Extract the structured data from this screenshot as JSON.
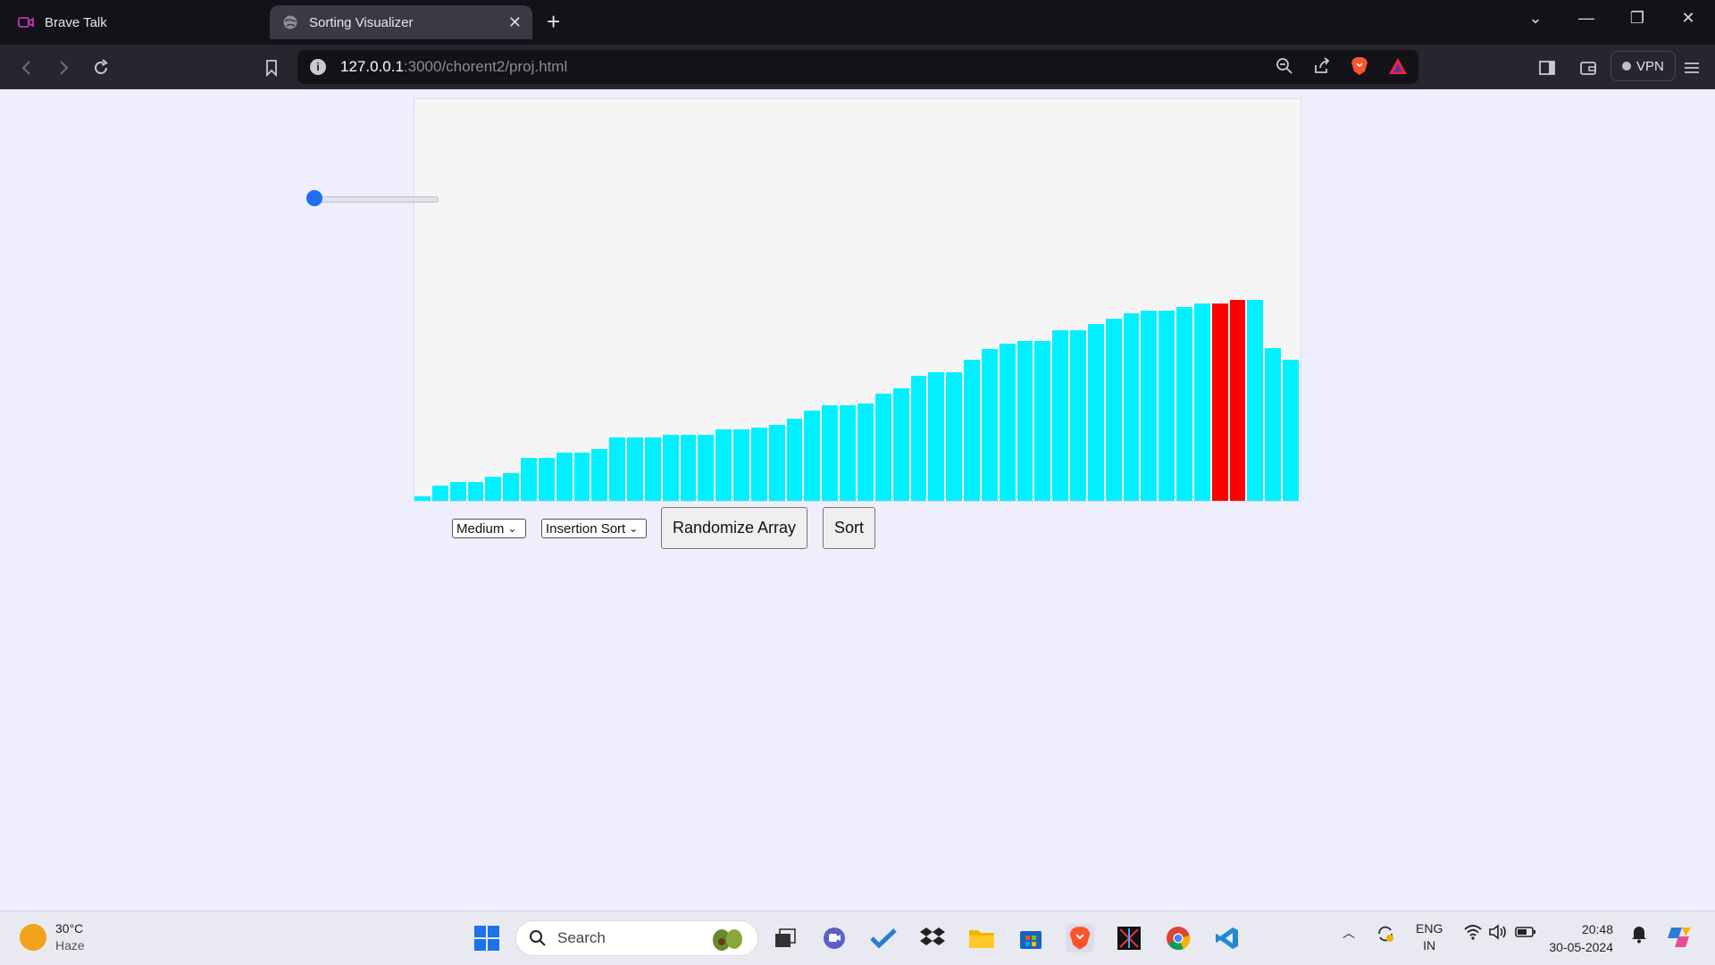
{
  "browser": {
    "tabs": [
      {
        "title": "Brave Talk",
        "active": false
      },
      {
        "title": "Sorting Visualizer",
        "active": true
      }
    ],
    "url_host": "127.0.0.1",
    "url_path": ":3000/chorent2/proj.html",
    "vpn_label": "VPN"
  },
  "controls": {
    "speed_select": "Medium",
    "algorithm_select": "Insertion Sort",
    "randomize_label": "Randomize Array",
    "sort_label": "Sort",
    "slider_value": 0
  },
  "colors": {
    "bar_default": "#00f0ff",
    "bar_active": "#ff0000",
    "canvas_bg": "#f5f5f5"
  },
  "chart_data": {
    "type": "bar",
    "max_value": 452,
    "values": [
      5,
      17,
      21,
      21,
      27,
      31,
      48,
      48,
      54,
      54,
      58,
      71,
      71,
      71,
      74,
      74,
      74,
      80,
      80,
      82,
      85,
      92,
      101,
      107,
      107,
      110,
      121,
      127,
      141,
      145,
      145,
      159,
      171,
      177,
      180,
      180,
      192,
      192,
      199,
      205,
      211,
      214,
      214,
      218,
      222,
      222,
      226,
      226,
      172,
      159
    ],
    "highlighted_indices": [
      45,
      46
    ]
  },
  "taskbar": {
    "temperature": "30°C",
    "weather": "Haze",
    "search_label": "Search",
    "lang_top": "ENG",
    "lang_bottom": "IN",
    "time": "20:48",
    "date": "30-05-2024"
  }
}
